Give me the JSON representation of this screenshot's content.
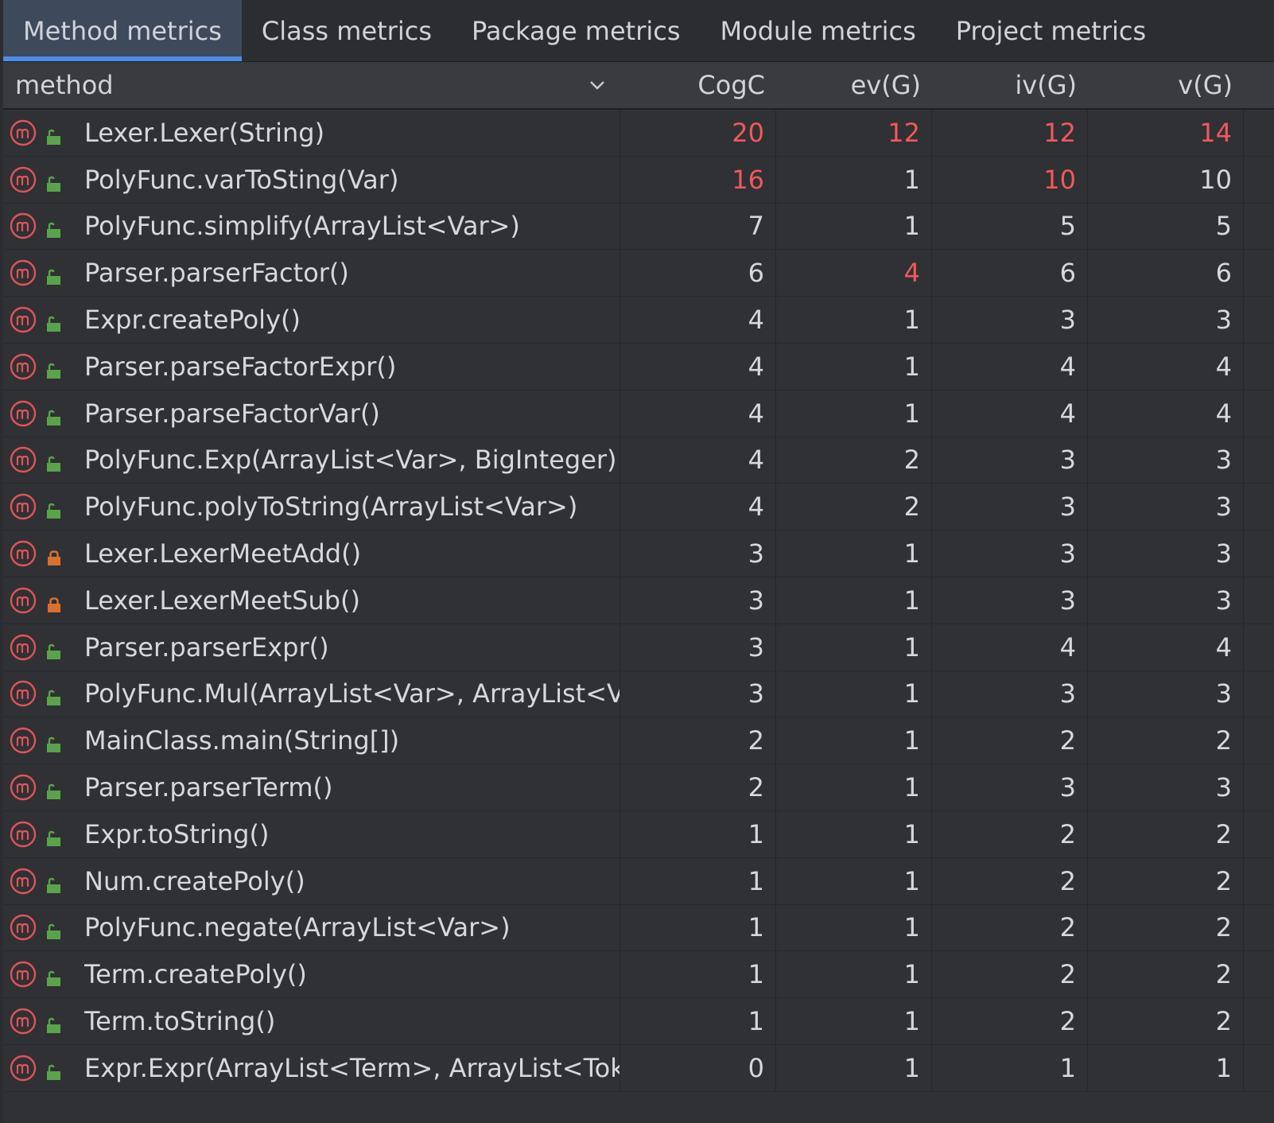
{
  "tabs": [
    {
      "label": "Method metrics",
      "active": true
    },
    {
      "label": "Class metrics",
      "active": false
    },
    {
      "label": "Package metrics",
      "active": false
    },
    {
      "label": "Module metrics",
      "active": false
    },
    {
      "label": "Project metrics",
      "active": false
    }
  ],
  "columns": [
    "method",
    "CogC",
    "ev(G)",
    "iv(G)",
    "v(G)"
  ],
  "sort_icon": "chevron-down-icon",
  "colors": {
    "warning_value": "#f0585d",
    "method_icon": "#e0535a",
    "public_visibility": "#5aa34a",
    "private_visibility": "#d9702e",
    "active_tab_accent": "#4b8ce8"
  },
  "rows": [
    {
      "method": "Lexer.Lexer(String)",
      "visibility": "public",
      "CogC": "20",
      "evG": "12",
      "ivG": "12",
      "vG": "14",
      "warn": [
        true,
        true,
        true,
        true
      ]
    },
    {
      "method": "PolyFunc.varToSting(Var)",
      "visibility": "public",
      "CogC": "16",
      "evG": "1",
      "ivG": "10",
      "vG": "10",
      "warn": [
        true,
        false,
        true,
        false
      ]
    },
    {
      "method": "PolyFunc.simplify(ArrayList<Var>)",
      "visibility": "public",
      "CogC": "7",
      "evG": "1",
      "ivG": "5",
      "vG": "5",
      "warn": [
        false,
        false,
        false,
        false
      ]
    },
    {
      "method": "Parser.parserFactor()",
      "visibility": "public",
      "CogC": "6",
      "evG": "4",
      "ivG": "6",
      "vG": "6",
      "warn": [
        false,
        true,
        false,
        false
      ]
    },
    {
      "method": "Expr.createPoly()",
      "visibility": "public",
      "CogC": "4",
      "evG": "1",
      "ivG": "3",
      "vG": "3",
      "warn": [
        false,
        false,
        false,
        false
      ]
    },
    {
      "method": "Parser.parseFactorExpr()",
      "visibility": "public",
      "CogC": "4",
      "evG": "1",
      "ivG": "4",
      "vG": "4",
      "warn": [
        false,
        false,
        false,
        false
      ]
    },
    {
      "method": "Parser.parseFactorVar()",
      "visibility": "public",
      "CogC": "4",
      "evG": "1",
      "ivG": "4",
      "vG": "4",
      "warn": [
        false,
        false,
        false,
        false
      ]
    },
    {
      "method": "PolyFunc.Exp(ArrayList<Var>, BigInteger)",
      "visibility": "public",
      "CogC": "4",
      "evG": "2",
      "ivG": "3",
      "vG": "3",
      "warn": [
        false,
        false,
        false,
        false
      ]
    },
    {
      "method": "PolyFunc.polyToString(ArrayList<Var>)",
      "visibility": "public",
      "CogC": "4",
      "evG": "2",
      "ivG": "3",
      "vG": "3",
      "warn": [
        false,
        false,
        false,
        false
      ]
    },
    {
      "method": "Lexer.LexerMeetAdd()",
      "visibility": "private",
      "CogC": "3",
      "evG": "1",
      "ivG": "3",
      "vG": "3",
      "warn": [
        false,
        false,
        false,
        false
      ]
    },
    {
      "method": "Lexer.LexerMeetSub()",
      "visibility": "private",
      "CogC": "3",
      "evG": "1",
      "ivG": "3",
      "vG": "3",
      "warn": [
        false,
        false,
        false,
        false
      ]
    },
    {
      "method": "Parser.parserExpr()",
      "visibility": "public",
      "CogC": "3",
      "evG": "1",
      "ivG": "4",
      "vG": "4",
      "warn": [
        false,
        false,
        false,
        false
      ]
    },
    {
      "method": "PolyFunc.Mul(ArrayList<Var>, ArrayList<Va",
      "visibility": "public",
      "CogC": "3",
      "evG": "1",
      "ivG": "3",
      "vG": "3",
      "warn": [
        false,
        false,
        false,
        false
      ]
    },
    {
      "method": "MainClass.main(String[])",
      "visibility": "public",
      "CogC": "2",
      "evG": "1",
      "ivG": "2",
      "vG": "2",
      "warn": [
        false,
        false,
        false,
        false
      ]
    },
    {
      "method": "Parser.parserTerm()",
      "visibility": "public",
      "CogC": "2",
      "evG": "1",
      "ivG": "3",
      "vG": "3",
      "warn": [
        false,
        false,
        false,
        false
      ]
    },
    {
      "method": "Expr.toString()",
      "visibility": "public",
      "CogC": "1",
      "evG": "1",
      "ivG": "2",
      "vG": "2",
      "warn": [
        false,
        false,
        false,
        false
      ]
    },
    {
      "method": "Num.createPoly()",
      "visibility": "public",
      "CogC": "1",
      "evG": "1",
      "ivG": "2",
      "vG": "2",
      "warn": [
        false,
        false,
        false,
        false
      ]
    },
    {
      "method": "PolyFunc.negate(ArrayList<Var>)",
      "visibility": "public",
      "CogC": "1",
      "evG": "1",
      "ivG": "2",
      "vG": "2",
      "warn": [
        false,
        false,
        false,
        false
      ]
    },
    {
      "method": "Term.createPoly()",
      "visibility": "public",
      "CogC": "1",
      "evG": "1",
      "ivG": "2",
      "vG": "2",
      "warn": [
        false,
        false,
        false,
        false
      ]
    },
    {
      "method": "Term.toString()",
      "visibility": "public",
      "CogC": "1",
      "evG": "1",
      "ivG": "2",
      "vG": "2",
      "warn": [
        false,
        false,
        false,
        false
      ]
    },
    {
      "method": "Expr.Expr(ArrayList<Term>, ArrayList<Toke",
      "visibility": "public",
      "CogC": "0",
      "evG": "1",
      "ivG": "1",
      "vG": "1",
      "warn": [
        false,
        false,
        false,
        false
      ]
    }
  ]
}
